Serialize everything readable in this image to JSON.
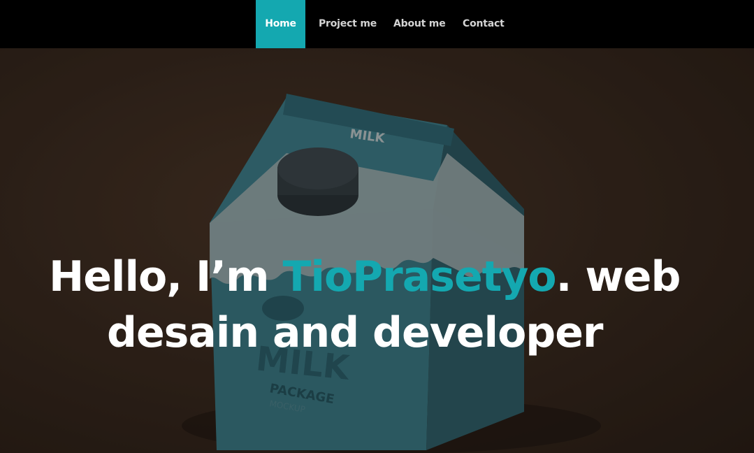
{
  "nav": {
    "items": [
      {
        "label": "Home",
        "active": true
      },
      {
        "label": "Project me",
        "active": false
      },
      {
        "label": "About me",
        "active": false
      },
      {
        "label": "Contact",
        "active": false
      }
    ]
  },
  "hero": {
    "greeting": "Hello, I’m ",
    "name": "TioPrasetyo",
    "after_name": ". web",
    "line2": "desain and developer",
    "image": {
      "description_icon": "milk-carton-image",
      "carton_top_label": "MILK",
      "carton_front_label": "MILK",
      "carton_sub_label": "PACKAGE",
      "carton_sub_label2": "MOCKUP"
    }
  },
  "colors": {
    "accent": "#14a8b0",
    "navbar": "#000000",
    "background": "#2a1d15",
    "text": "#ffffff"
  }
}
